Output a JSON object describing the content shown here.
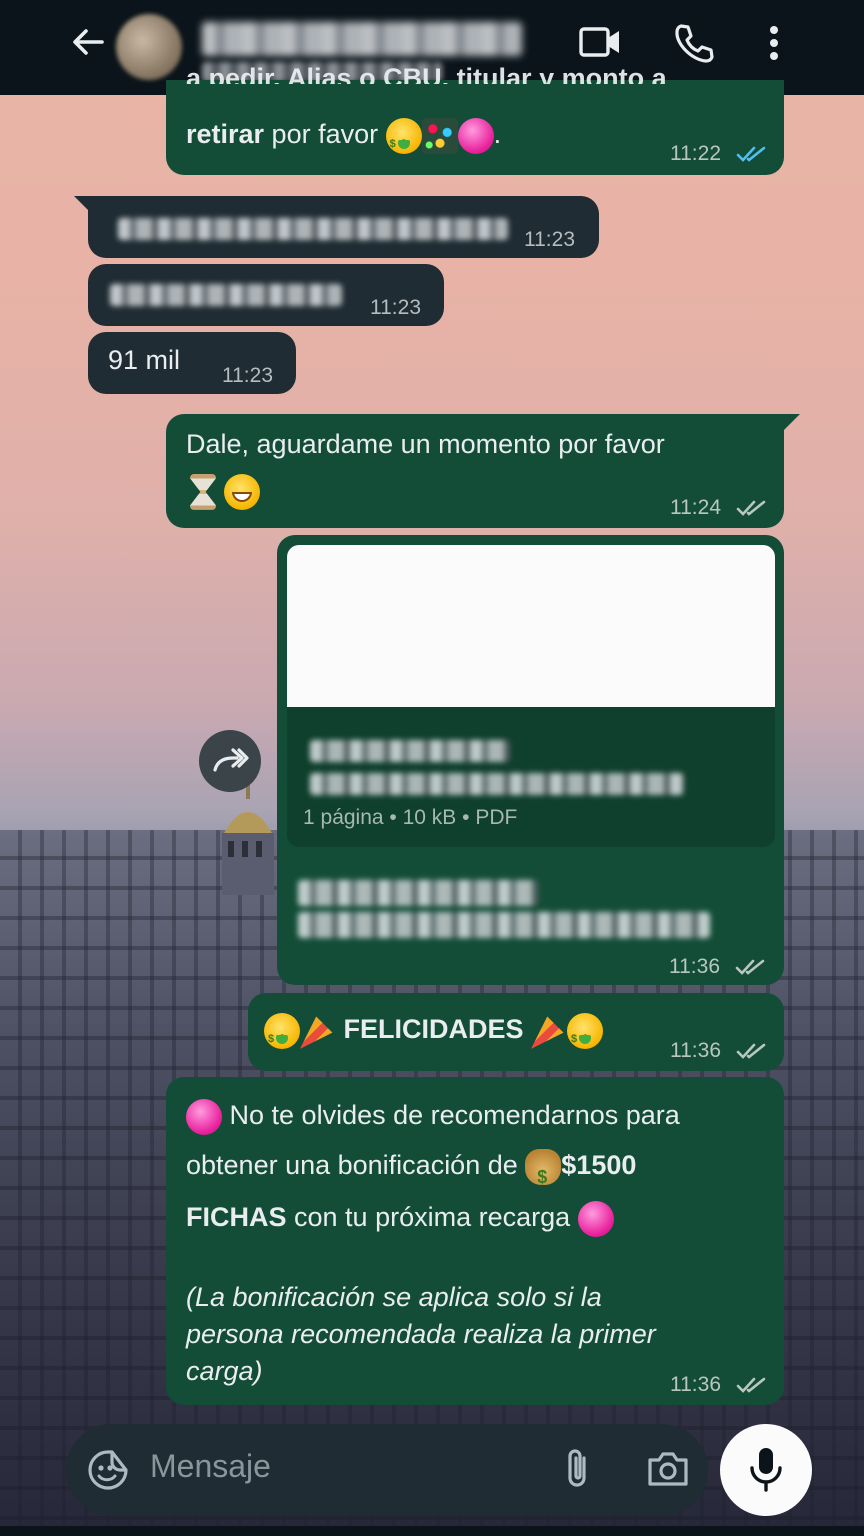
{
  "header": {
    "contact_name": "",
    "contact_status": ""
  },
  "messages": {
    "m1": {
      "line1_partial": "a pedir. Alias o CBU, titular y monto a",
      "bold": "retirar",
      "rest": " por favor",
      "time": "11:22"
    },
    "m2": {
      "time": "11:23"
    },
    "m3": {
      "time": "11:23"
    },
    "m4": {
      "text": "91 mil",
      "time": "11:23"
    },
    "m5": {
      "line1": "Dale, aguardame un momento por favor",
      "time": "11:24"
    },
    "m6": {
      "doc_meta": "1 página • 10 kB • PDF",
      "time": "11:36"
    },
    "m7": {
      "text": "FELICIDADES",
      "time": "11:36"
    },
    "m8": {
      "l1": "No te olvides de recomendarnos para",
      "l2a": "obtener una bonificación de",
      "l2b": "$1500",
      "l3a": "FICHAS",
      "l3b": "con tu próxima recarga",
      "note1": "(La bonificación se aplica solo si la",
      "note2": "persona recomendada realiza la primer",
      "note3": "carga)",
      "time": "11:36"
    }
  },
  "input": {
    "placeholder": "Mensaje"
  },
  "icons": {
    "back": "back-arrow-icon",
    "video": "video-call-icon",
    "phone": "phone-icon",
    "menu": "more-vert-icon",
    "forward": "forward-icon",
    "sticker": "sticker-icon",
    "attach": "paperclip-icon",
    "camera": "camera-icon",
    "mic": "mic-icon"
  },
  "colors": {
    "outgoing": "#134d37",
    "incoming": "#1f2c33",
    "header": "#0b141a",
    "read_ticks": "#53bdeb"
  }
}
